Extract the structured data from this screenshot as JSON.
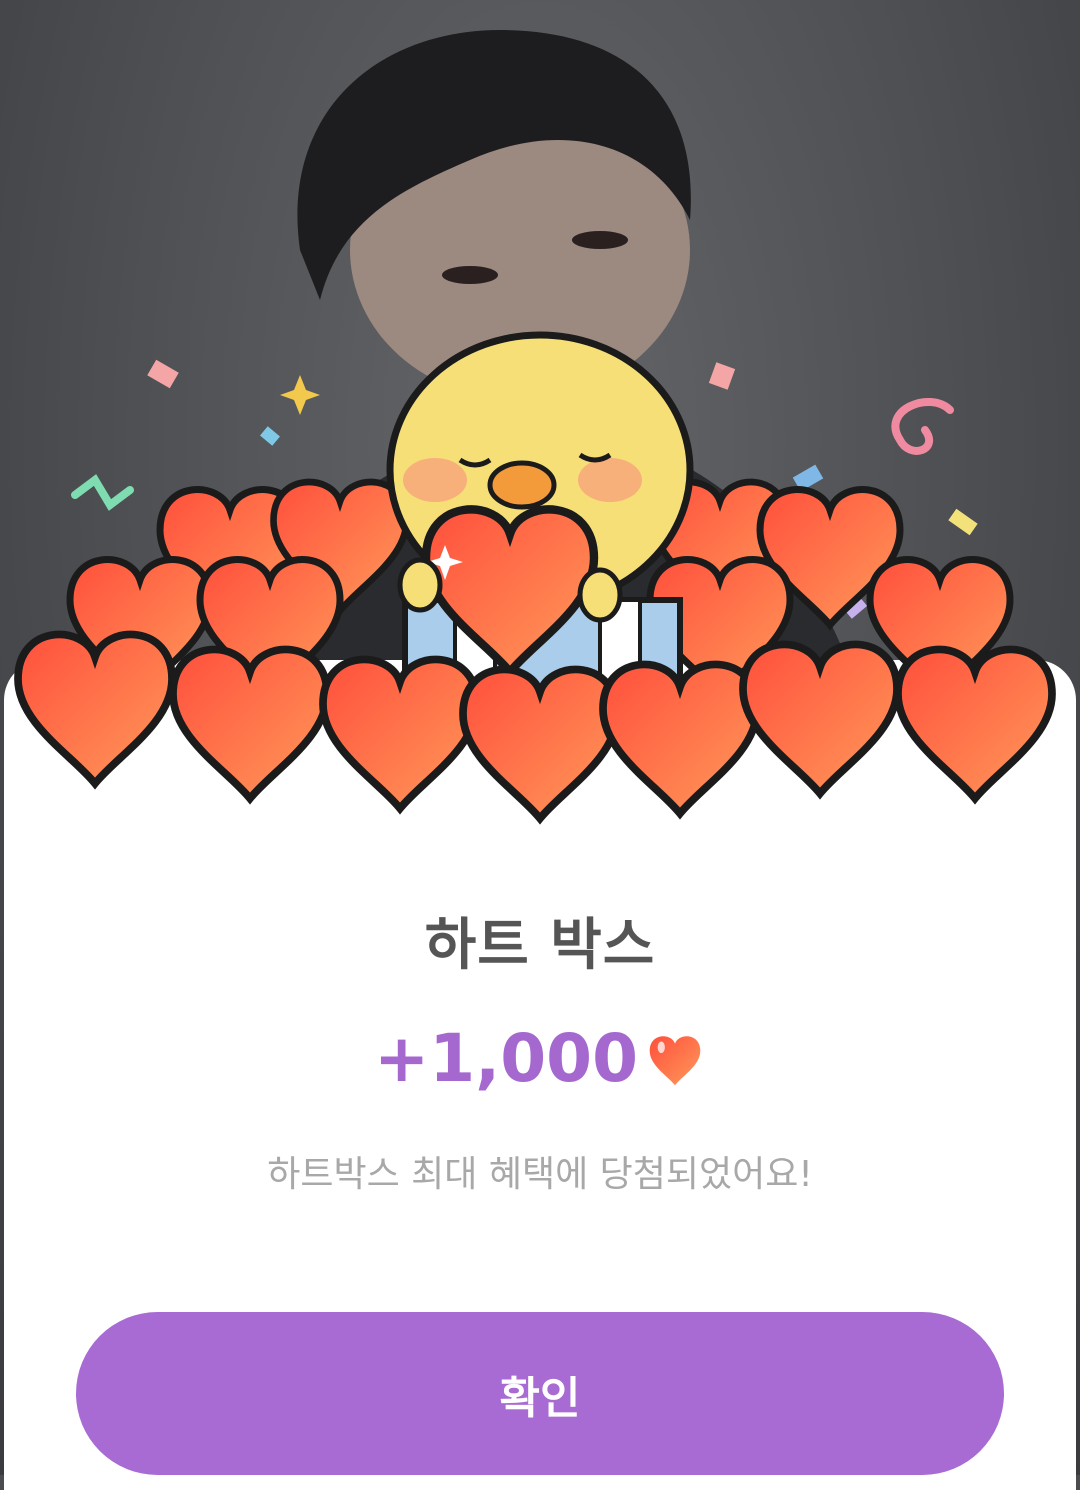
{
  "dialog": {
    "title": "하트 박스",
    "amount": "+1,000",
    "message": "하트박스 최대 혜택에 당첨되었어요!",
    "confirm_label": "확인"
  },
  "colors": {
    "accent": "#a86ad3",
    "amount_text": "#a468cf",
    "title_text": "#555555",
    "message_text": "#a8a8a8",
    "heart": "#ff6a4a"
  },
  "icons": [
    "heart-icon",
    "duck-mascot",
    "confetti"
  ]
}
